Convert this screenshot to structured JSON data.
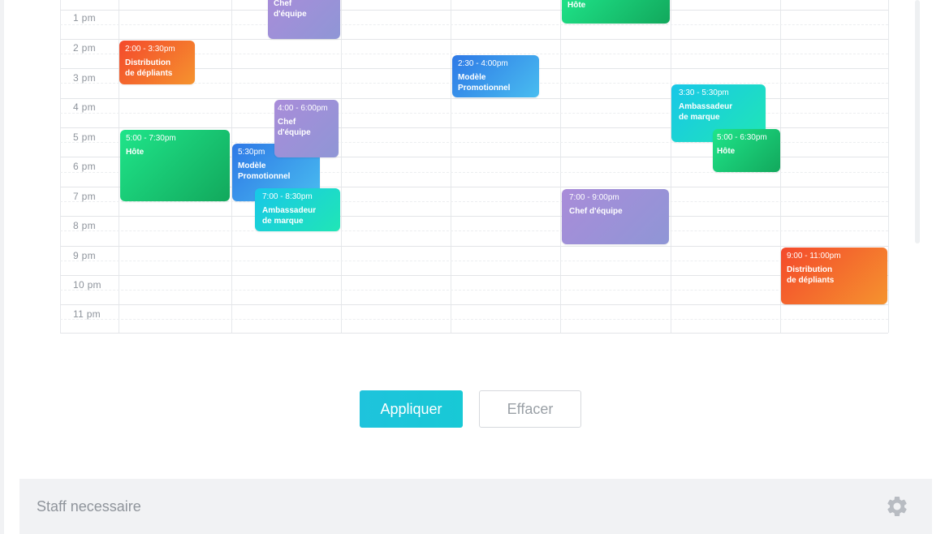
{
  "calendar": {
    "time_labels": [
      "1 pm",
      "2 pm",
      "3 pm",
      "4 pm",
      "5 pm",
      "6 pm",
      "7 pm",
      "8 pm",
      "9 pm",
      "10 pm",
      "11 pm"
    ],
    "events": [
      {
        "time": "",
        "title": "Chef\nd'équipe",
        "color": "purple"
      },
      {
        "time": "",
        "title": "Hôte",
        "color": "green"
      },
      {
        "time": "2:00 - 3:30pm",
        "title": "Distribution\nde dépliants",
        "color": "orange"
      },
      {
        "time": "2:30 - 4:00pm",
        "title": "Modèle\nPromotionnel",
        "color": "blue"
      },
      {
        "time": "3:30 - 5:30pm",
        "title": "Ambassadeur\nde marque",
        "color": "teal"
      },
      {
        "time": "4:00 - 6:00pm",
        "title": "Chef\nd'équipe",
        "color": "purple"
      },
      {
        "time": "5:00 - 7:30pm",
        "title": "Hôte",
        "color": "green"
      },
      {
        "time": "5:00 - 6:30pm",
        "title": "Hôte",
        "color": "green"
      },
      {
        "time": "5:30pm",
        "title": "Modèle\nPromotionnel",
        "color": "blue"
      },
      {
        "time": "7:00 - 8:30pm",
        "title": "Ambassadeur\nde marque",
        "color": "teal"
      },
      {
        "time": "7:00 - 9:00pm",
        "title": "Chef d'équipe",
        "color": "purple"
      },
      {
        "time": "9:00 - 11:00pm",
        "title": "Distribution\nde dépliants",
        "color": "orange"
      }
    ]
  },
  "actions": {
    "apply_label": "Appliquer",
    "clear_label": "Effacer"
  },
  "staff_panel": {
    "title": "Staff necessaire",
    "icon": "gear-icon"
  },
  "colors": {
    "apply_button": "#1ec3dc",
    "panel_background": "#f1f2f4"
  }
}
